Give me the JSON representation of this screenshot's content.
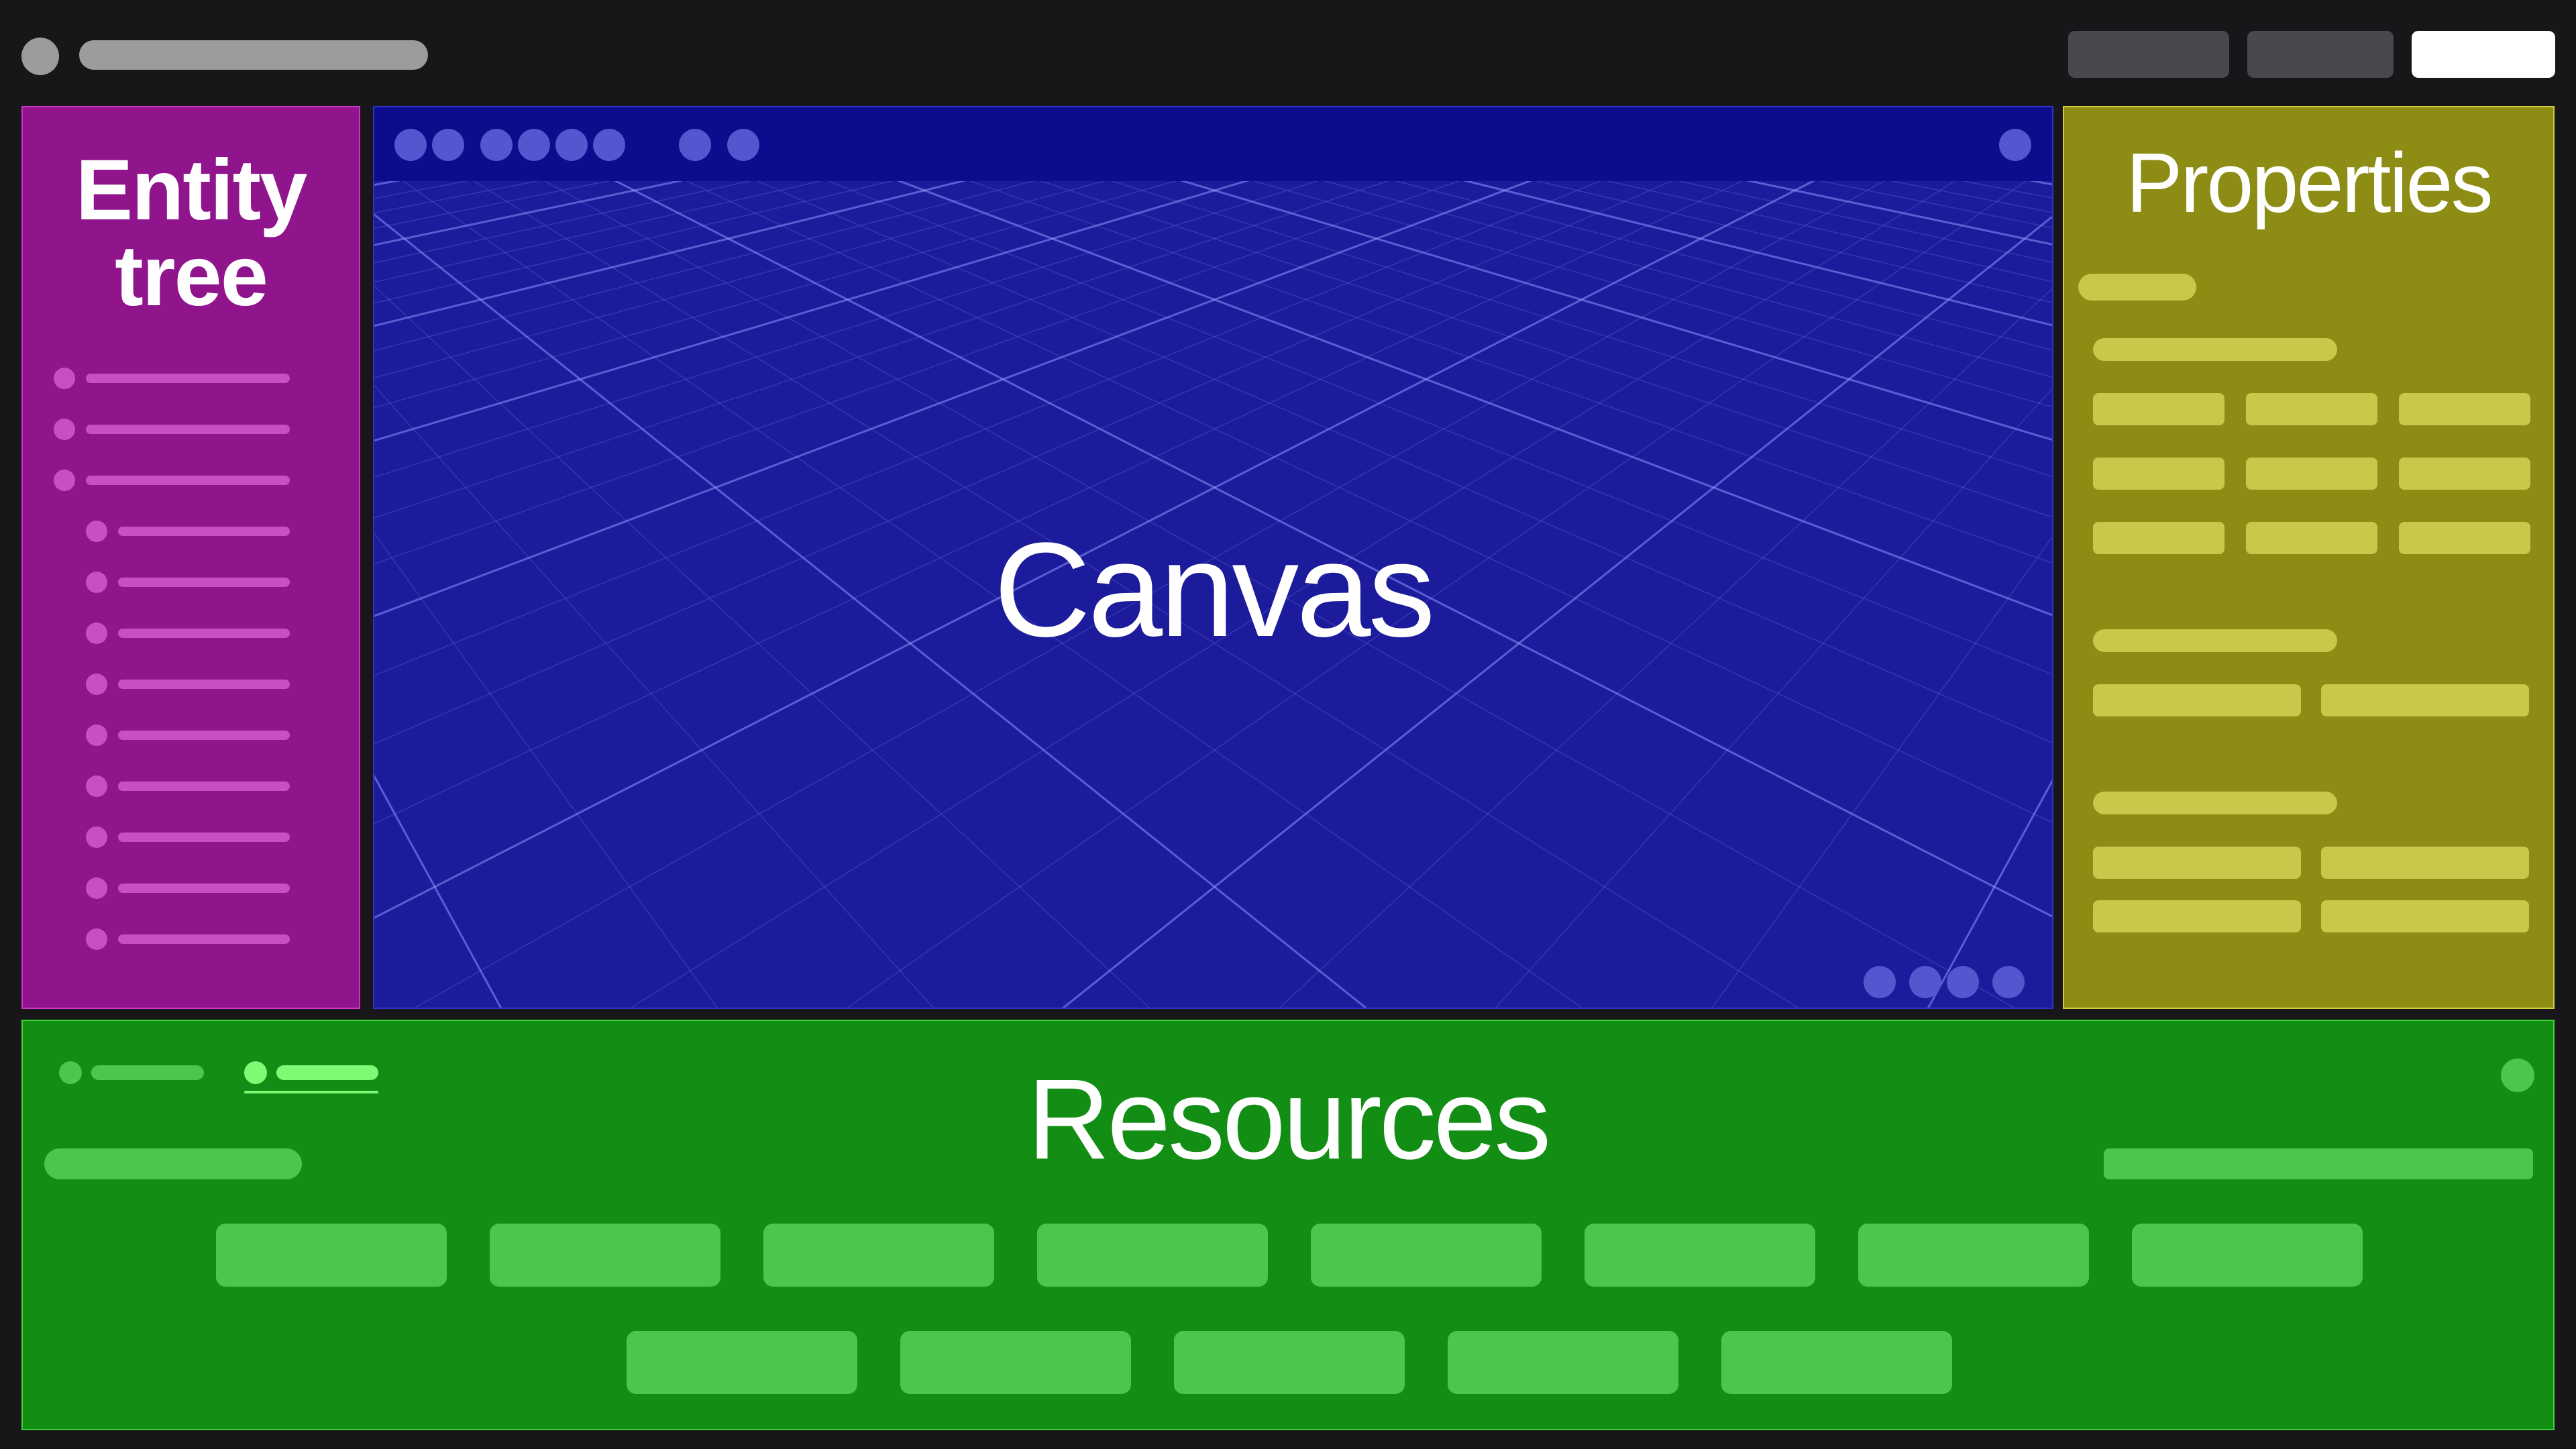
{
  "entity_tree": {
    "title": "Entity\ntree"
  },
  "canvas": {
    "title": "Canvas"
  },
  "properties": {
    "title": "Properties"
  },
  "resources": {
    "title": "Resources"
  },
  "colors": {
    "background": "#19161a",
    "entity_tree": "#90148c",
    "canvas": "#1c1b9b",
    "properties": "#8d8c14",
    "resources": "#138e15"
  }
}
